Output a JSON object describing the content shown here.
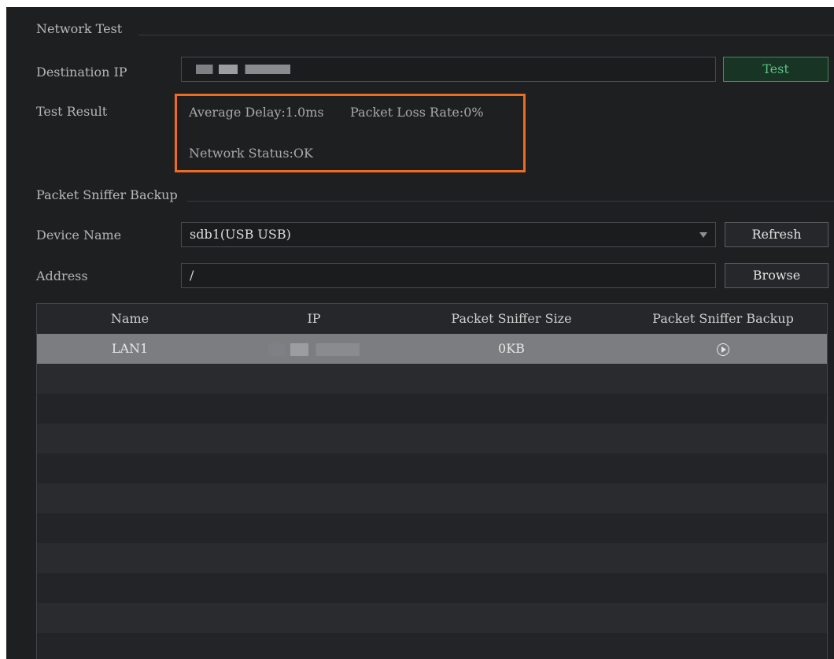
{
  "network_test": {
    "section_title": "Network Test",
    "destination_ip_label": "Destination IP",
    "destination_ip_value": "",
    "test_button": "Test",
    "test_result_label": "Test Result",
    "average_delay": "Average Delay:1.0ms",
    "packet_loss_rate": "Packet Loss Rate:0%",
    "network_status": "Network Status:OK",
    "highlight_color": "#ee6b22"
  },
  "packet_sniffer": {
    "section_title": "Packet Sniffer Backup",
    "device_name_label": "Device Name",
    "device_name_value": "sdb1(USB USB)",
    "refresh_button": "Refresh",
    "address_label": "Address",
    "address_value": "/",
    "browse_button": "Browse",
    "table": {
      "headers": [
        "Name",
        "IP",
        "Packet Sniffer Size",
        "Packet Sniffer Backup"
      ],
      "rows": [
        {
          "name": "LAN1",
          "ip": "",
          "size": "0KB",
          "backup_icon": "play-circle-icon"
        }
      ]
    }
  },
  "colors": {
    "background": "#1e1f21",
    "selected_row": "#7c7d80",
    "test_button_accent": "#5fc186"
  }
}
